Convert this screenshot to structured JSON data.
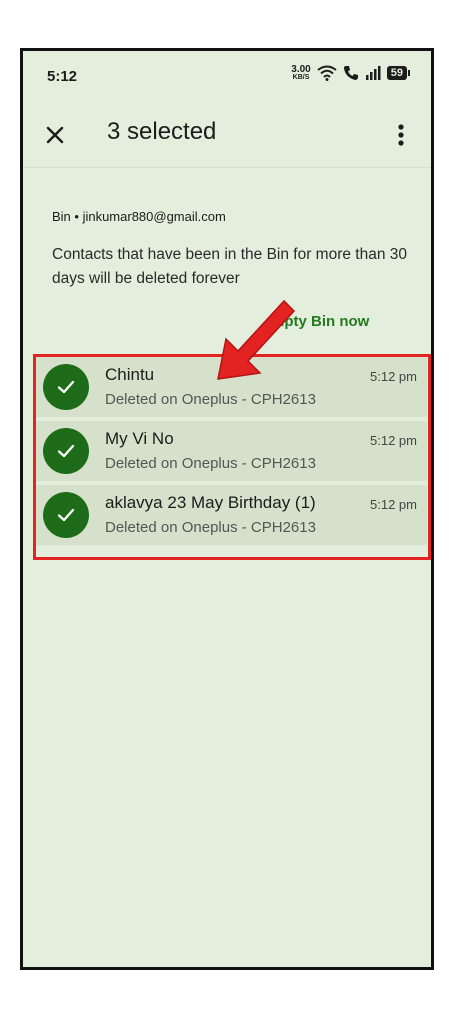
{
  "status_bar": {
    "time": "5:12",
    "speed_value": "3.00",
    "speed_unit": "KB/S",
    "battery": "59",
    "icons": [
      "wifi-icon",
      "call-icon",
      "signal-icon",
      "battery-icon"
    ]
  },
  "app_bar": {
    "title": "3 selected",
    "close_icon": "close-icon",
    "more_icon": "more-vert-icon"
  },
  "bin": {
    "account": "Bin • jinkumar880@gmail.com",
    "info": "Contacts that have been in the Bin for more than 30 days will be deleted forever",
    "empty_button": "mpty Bin now"
  },
  "contacts": [
    {
      "name": "Chintu",
      "subtitle": "Deleted on Oneplus - CPH2613",
      "time": "5:12 pm"
    },
    {
      "name": "My Vi No",
      "subtitle": "Deleted on Oneplus - CPH2613",
      "time": "5:12 pm"
    },
    {
      "name": "aklavya 23 May Birthday (1)",
      "subtitle": "Deleted on Oneplus - CPH2613",
      "time": "5:12 pm"
    }
  ],
  "colors": {
    "background": "#e4eedc",
    "row_selected": "#d6e1cc",
    "check": "#1e6b1a",
    "accent": "#237a1f",
    "highlight": "#e32222"
  }
}
